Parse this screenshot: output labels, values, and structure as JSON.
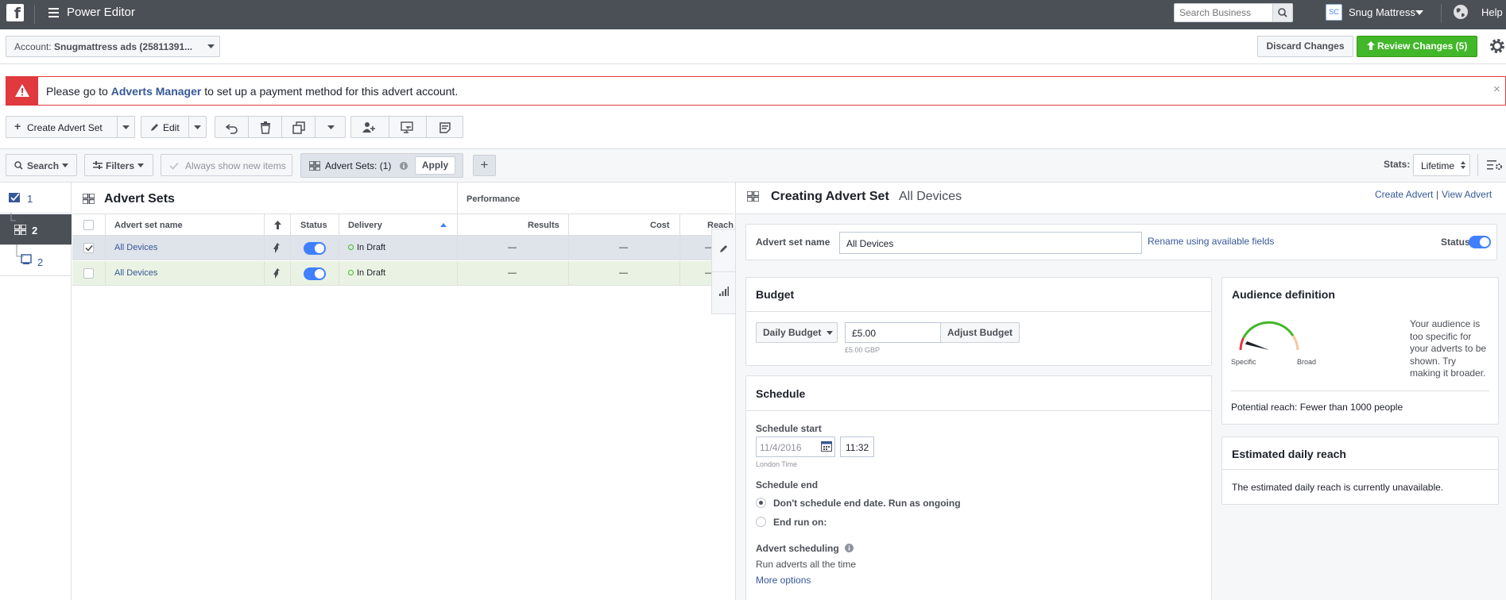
{
  "topbar": {
    "logo": "f",
    "app_title": "Power Editor",
    "search_placeholder": "Search Business",
    "business_initials": "SC",
    "business_name": "Snug Mattress",
    "help": "Help"
  },
  "account": {
    "prefix": "Account:",
    "name": "Snugmattress ads (25811391..."
  },
  "actions": {
    "discard": "Discard Changes",
    "review": "Review Changes (5)"
  },
  "alert": {
    "before": "Please go to ",
    "link": "Adverts Manager",
    "after": " to set up a payment method for this advert account.",
    "close": "×"
  },
  "toolbar": {
    "create": "Create Advert Set",
    "edit": "Edit"
  },
  "filterbar": {
    "search": "Search",
    "filters": "Filters",
    "always_show": "Always show new items",
    "advert_sets_chip": "Advert Sets: (1)",
    "apply": "Apply",
    "add": "+",
    "stats_label": "Stats:",
    "stats_value": "Lifetime"
  },
  "rail": {
    "item1": "1",
    "item2": "2",
    "item3": "2"
  },
  "table": {
    "title": "Advert Sets",
    "performance": "Performance",
    "columns": {
      "name": "Advert set name",
      "status": "Status",
      "delivery": "Delivery",
      "results": "Results",
      "cost": "Cost",
      "reach": "Reach"
    },
    "rows": [
      {
        "name": "All Devices",
        "delivery": "In Draft",
        "results": "—",
        "cost": "—",
        "reach": "—"
      },
      {
        "name": "All Devices",
        "delivery": "In Draft",
        "results": "—",
        "cost": "—",
        "reach": "—"
      }
    ]
  },
  "panel": {
    "heading": "Creating Advert Set",
    "subject": "All Devices",
    "create_advert": "Create Advert",
    "divider": "|",
    "view_advert": "View Advert",
    "name_label": "Advert set name",
    "name_value": "All Devices",
    "rename_link": "Rename using available fields",
    "status_label": "Status"
  },
  "budget": {
    "title": "Budget",
    "type": "Daily Budget",
    "amount": "£5.00",
    "amount_hint": "£5.00 GBP",
    "adjust": "Adjust Budget"
  },
  "schedule": {
    "title": "Schedule",
    "start_label": "Schedule start",
    "start_date": "11/4/2016",
    "start_time": "11:32",
    "timezone": "London Time",
    "end_label": "Schedule end",
    "option_ongoing": "Don't schedule end date. Run as ongoing",
    "option_end": "End run on:",
    "advert_scheduling": "Advert scheduling",
    "run_all": "Run adverts all the time",
    "more_options": "More options"
  },
  "audience": {
    "title": "Audience definition",
    "specific": "Specific",
    "broad": "Broad",
    "message": "Your audience is too specific for your adverts to be shown. Try making it broader.",
    "potential_reach": "Potential reach: Fewer than 1000 people",
    "gauge_level": 0.1
  },
  "estimated": {
    "title": "Estimated daily reach",
    "text": "The estimated daily reach is currently unavailable."
  },
  "colors": {
    "topbar": "#4b4f56",
    "alert": "#e0393e",
    "review": "#42b72a",
    "link": "#365899",
    "toggle": "#4080ff"
  }
}
